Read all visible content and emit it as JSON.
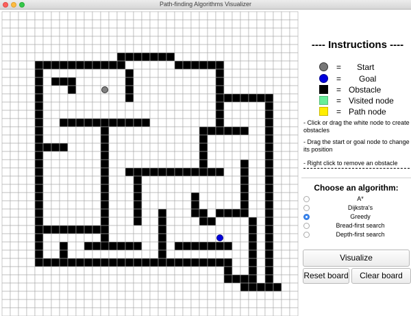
{
  "window": {
    "title": "Path-finding Algorithms Visualizer"
  },
  "colors": {
    "start": "#808080",
    "goal": "#0000dd",
    "obstacle": "#000000",
    "visited": "#66ee99",
    "path": "#ffee00",
    "grid_line": "#a8a8a8"
  },
  "grid": {
    "cols": 36,
    "rows": 37,
    "start": [
      12,
      9
    ],
    "goal": [
      26,
      27
    ],
    "walls": [
      [
        14,
        5
      ],
      [
        15,
        5
      ],
      [
        16,
        5
      ],
      [
        17,
        5
      ],
      [
        18,
        5
      ],
      [
        19,
        5
      ],
      [
        20,
        5
      ],
      [
        4,
        6
      ],
      [
        5,
        6
      ],
      [
        6,
        6
      ],
      [
        7,
        6
      ],
      [
        8,
        6
      ],
      [
        9,
        6
      ],
      [
        10,
        6
      ],
      [
        11,
        6
      ],
      [
        12,
        6
      ],
      [
        13,
        6
      ],
      [
        14,
        6
      ],
      [
        21,
        6
      ],
      [
        22,
        6
      ],
      [
        23,
        6
      ],
      [
        24,
        6
      ],
      [
        25,
        6
      ],
      [
        26,
        6
      ],
      [
        4,
        7
      ],
      [
        15,
        7
      ],
      [
        26,
        7
      ],
      [
        4,
        8
      ],
      [
        6,
        8
      ],
      [
        7,
        8
      ],
      [
        8,
        8
      ],
      [
        15,
        8
      ],
      [
        26,
        8
      ],
      [
        4,
        9
      ],
      [
        8,
        9
      ],
      [
        15,
        9
      ],
      [
        26,
        9
      ],
      [
        4,
        10
      ],
      [
        15,
        10
      ],
      [
        26,
        10
      ],
      [
        27,
        10
      ],
      [
        28,
        10
      ],
      [
        29,
        10
      ],
      [
        30,
        10
      ],
      [
        31,
        10
      ],
      [
        32,
        10
      ],
      [
        4,
        11
      ],
      [
        26,
        11
      ],
      [
        32,
        11
      ],
      [
        4,
        12
      ],
      [
        26,
        12
      ],
      [
        32,
        12
      ],
      [
        4,
        13
      ],
      [
        7,
        13
      ],
      [
        8,
        13
      ],
      [
        9,
        13
      ],
      [
        10,
        13
      ],
      [
        11,
        13
      ],
      [
        12,
        13
      ],
      [
        13,
        13
      ],
      [
        14,
        13
      ],
      [
        15,
        13
      ],
      [
        16,
        13
      ],
      [
        17,
        13
      ],
      [
        26,
        13
      ],
      [
        32,
        13
      ],
      [
        4,
        14
      ],
      [
        12,
        14
      ],
      [
        24,
        14
      ],
      [
        25,
        14
      ],
      [
        26,
        14
      ],
      [
        27,
        14
      ],
      [
        28,
        14
      ],
      [
        29,
        14
      ],
      [
        32,
        14
      ],
      [
        4,
        15
      ],
      [
        12,
        15
      ],
      [
        24,
        15
      ],
      [
        32,
        15
      ],
      [
        4,
        16
      ],
      [
        5,
        16
      ],
      [
        6,
        16
      ],
      [
        7,
        16
      ],
      [
        12,
        16
      ],
      [
        24,
        16
      ],
      [
        32,
        16
      ],
      [
        4,
        17
      ],
      [
        12,
        17
      ],
      [
        24,
        17
      ],
      [
        32,
        17
      ],
      [
        4,
        18
      ],
      [
        12,
        18
      ],
      [
        24,
        18
      ],
      [
        29,
        18
      ],
      [
        32,
        18
      ],
      [
        4,
        19
      ],
      [
        12,
        19
      ],
      [
        15,
        19
      ],
      [
        16,
        19
      ],
      [
        17,
        19
      ],
      [
        18,
        19
      ],
      [
        19,
        19
      ],
      [
        20,
        19
      ],
      [
        21,
        19
      ],
      [
        22,
        19
      ],
      [
        23,
        19
      ],
      [
        24,
        19
      ],
      [
        25,
        19
      ],
      [
        26,
        19
      ],
      [
        29,
        19
      ],
      [
        32,
        19
      ],
      [
        4,
        20
      ],
      [
        12,
        20
      ],
      [
        16,
        20
      ],
      [
        29,
        20
      ],
      [
        32,
        20
      ],
      [
        4,
        21
      ],
      [
        12,
        21
      ],
      [
        16,
        21
      ],
      [
        29,
        21
      ],
      [
        32,
        21
      ],
      [
        4,
        22
      ],
      [
        12,
        22
      ],
      [
        16,
        22
      ],
      [
        23,
        22
      ],
      [
        29,
        22
      ],
      [
        32,
        22
      ],
      [
        4,
        23
      ],
      [
        12,
        23
      ],
      [
        16,
        23
      ],
      [
        23,
        23
      ],
      [
        29,
        23
      ],
      [
        32,
        23
      ],
      [
        4,
        24
      ],
      [
        12,
        24
      ],
      [
        16,
        24
      ],
      [
        19,
        24
      ],
      [
        23,
        24
      ],
      [
        24,
        24
      ],
      [
        26,
        24
      ],
      [
        27,
        24
      ],
      [
        28,
        24
      ],
      [
        29,
        24
      ],
      [
        32,
        24
      ],
      [
        4,
        25
      ],
      [
        12,
        25
      ],
      [
        16,
        25
      ],
      [
        19,
        25
      ],
      [
        24,
        25
      ],
      [
        25,
        25
      ],
      [
        30,
        25
      ],
      [
        32,
        25
      ],
      [
        4,
        26
      ],
      [
        5,
        26
      ],
      [
        6,
        26
      ],
      [
        7,
        26
      ],
      [
        8,
        26
      ],
      [
        9,
        26
      ],
      [
        10,
        26
      ],
      [
        11,
        26
      ],
      [
        12,
        26
      ],
      [
        19,
        26
      ],
      [
        30,
        26
      ],
      [
        32,
        26
      ],
      [
        4,
        27
      ],
      [
        12,
        27
      ],
      [
        19,
        27
      ],
      [
        30,
        27
      ],
      [
        32,
        27
      ],
      [
        4,
        28
      ],
      [
        7,
        28
      ],
      [
        10,
        28
      ],
      [
        11,
        28
      ],
      [
        12,
        28
      ],
      [
        13,
        28
      ],
      [
        14,
        28
      ],
      [
        15,
        28
      ],
      [
        16,
        28
      ],
      [
        19,
        28
      ],
      [
        21,
        28
      ],
      [
        22,
        28
      ],
      [
        23,
        28
      ],
      [
        24,
        28
      ],
      [
        25,
        28
      ],
      [
        26,
        28
      ],
      [
        27,
        28
      ],
      [
        30,
        28
      ],
      [
        32,
        28
      ],
      [
        4,
        29
      ],
      [
        7,
        29
      ],
      [
        19,
        29
      ],
      [
        30,
        29
      ],
      [
        32,
        29
      ],
      [
        4,
        30
      ],
      [
        5,
        30
      ],
      [
        6,
        30
      ],
      [
        7,
        30
      ],
      [
        8,
        30
      ],
      [
        9,
        30
      ],
      [
        10,
        30
      ],
      [
        11,
        30
      ],
      [
        12,
        30
      ],
      [
        13,
        30
      ],
      [
        14,
        30
      ],
      [
        15,
        30
      ],
      [
        16,
        30
      ],
      [
        17,
        30
      ],
      [
        18,
        30
      ],
      [
        19,
        30
      ],
      [
        20,
        30
      ],
      [
        21,
        30
      ],
      [
        22,
        30
      ],
      [
        23,
        30
      ],
      [
        24,
        30
      ],
      [
        25,
        30
      ],
      [
        26,
        30
      ],
      [
        27,
        30
      ],
      [
        30,
        30
      ],
      [
        32,
        30
      ],
      [
        27,
        31
      ],
      [
        30,
        31
      ],
      [
        32,
        31
      ],
      [
        27,
        32
      ],
      [
        28,
        32
      ],
      [
        29,
        32
      ],
      [
        30,
        32
      ],
      [
        32,
        32
      ],
      [
        29,
        33
      ],
      [
        30,
        33
      ],
      [
        31,
        33
      ],
      [
        32,
        33
      ],
      [
        33,
        33
      ]
    ]
  },
  "instructions": {
    "title": "---- Instructions ----",
    "legend": [
      {
        "icon": "start-circle-icon",
        "eq": "=",
        "label": "Start"
      },
      {
        "icon": "goal-circle-icon",
        "eq": "=",
        "label": "Goal"
      },
      {
        "icon": "obstacle-square-icon",
        "eq": "=",
        "label": "Obstacle"
      },
      {
        "icon": "visited-square-icon",
        "eq": "=",
        "label": "Visited node"
      },
      {
        "icon": "path-square-icon",
        "eq": "=",
        "label": "Path node"
      }
    ],
    "tips": [
      "- Click or drag the white node to create obstacles",
      "- Drag the start or goal node to change its position",
      "- Right click to remove an obstacle"
    ]
  },
  "algorithms": {
    "title": "Choose an algorithm:",
    "options": [
      "A*",
      "Dijkstra's",
      "Greedy",
      "Bread-first search",
      "Depth-first search"
    ],
    "selected_index": 2
  },
  "buttons": {
    "visualize": "Visualize",
    "reset": "Reset board",
    "clear": "Clear board"
  }
}
